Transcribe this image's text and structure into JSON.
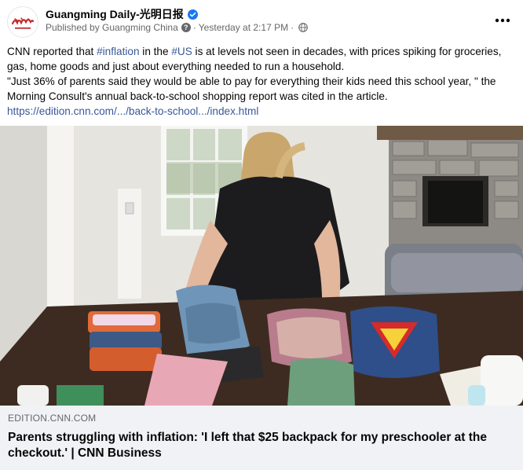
{
  "header": {
    "page_name": "Guangming Daily-光明日报",
    "published_by": "Published by Guangming China",
    "help_glyph": "?",
    "separator": "·",
    "timestamp": "Yesterday at 2:17 PM",
    "privacy_icon": "globe-icon",
    "verified_icon": "verified-badge-icon",
    "more_icon": "more-horizontal-icon"
  },
  "post": {
    "line1_pre": "CNN reported that ",
    "hashtag1": "#inflation",
    "line1_mid": " in the ",
    "hashtag2": "#US",
    "line1_post": " is at levels not seen in decades, with prices spiking for groceries, gas, home goods and just about everything needed to run a household.",
    "quote": "\"Just 36% of parents said they would be able to pay for everything their kids need this school year, \" the Morning Consult's annual back-to-school shopping report was cited in the article.",
    "link": "https://edition.cnn.com/.../back-to-school.../index.html"
  },
  "link_preview": {
    "domain": "EDITION.CNN.COM",
    "title": "Parents struggling with inflation: 'I left that $25 backpack for my preschooler at the checkout.' | CNN Business"
  },
  "colors": {
    "link": "#385898",
    "verified": "#1877f2",
    "secondary_text": "#65676b",
    "preview_bg": "#f0f2f5"
  }
}
